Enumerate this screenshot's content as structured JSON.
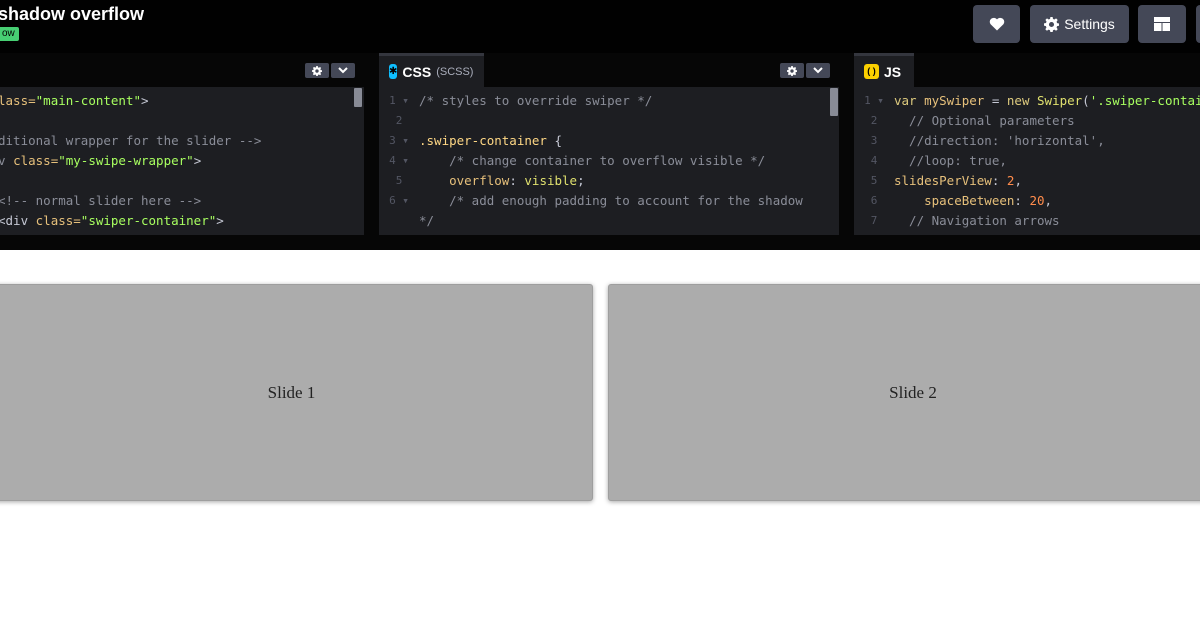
{
  "header": {
    "title": "shadow overflow",
    "badge": "ow",
    "settings_label": "Settings"
  },
  "panes": {
    "html": {
      "lines": [
        {
          "num": "",
          "fold": false,
          "parts": [
            {
              "t": "lass=",
              "c": "sl-attr"
            },
            {
              "t": "\"main-content\"",
              "c": "sl-str"
            },
            {
              "t": ">",
              "c": ""
            }
          ]
        },
        {
          "num": "",
          "fold": false,
          "parts": []
        },
        {
          "num": "",
          "fold": false,
          "parts": [
            {
              "t": "ditional wrapper for the slider -->",
              "c": "sl-com"
            }
          ]
        },
        {
          "num": "",
          "fold": false,
          "parts": [
            {
              "t": "v ",
              "c": "sl-com"
            },
            {
              "t": "class=",
              "c": "sl-attr"
            },
            {
              "t": "\"my-swipe-wrapper\"",
              "c": "sl-str"
            },
            {
              "t": ">",
              "c": ""
            }
          ]
        },
        {
          "num": "",
          "fold": false,
          "parts": []
        },
        {
          "num": "",
          "fold": false,
          "parts": [
            {
              "t": "<!-- normal slider here -->",
              "c": "sl-com"
            }
          ]
        },
        {
          "num": "",
          "fold": false,
          "parts": [
            {
              "t": "<div ",
              "c": ""
            },
            {
              "t": "class=",
              "c": "sl-attr"
            },
            {
              "t": "\"swiper-container\"",
              "c": "sl-str"
            },
            {
              "t": ">",
              "c": ""
            }
          ]
        }
      ]
    },
    "css": {
      "tab_label": "CSS",
      "tab_sub": "(SCSS)",
      "lines": [
        {
          "num": "1",
          "fold": true,
          "parts": [
            {
              "t": "/* styles to override swiper */",
              "c": "sl-com"
            }
          ]
        },
        {
          "num": "2",
          "fold": false,
          "parts": []
        },
        {
          "num": "3",
          "fold": true,
          "parts": [
            {
              "t": ".swiper-container",
              "c": "sl-sel"
            },
            {
              "t": " {",
              "c": ""
            }
          ]
        },
        {
          "num": "4",
          "fold": true,
          "parts": [
            {
              "t": "    /* change container to overflow visible */",
              "c": "sl-com"
            }
          ]
        },
        {
          "num": "5",
          "fold": false,
          "parts": [
            {
              "t": "    ",
              "c": ""
            },
            {
              "t": "overflow",
              "c": "sl-attr"
            },
            {
              "t": ": ",
              "c": ""
            },
            {
              "t": "visible",
              "c": "sl-fn"
            },
            {
              "t": ";",
              "c": ""
            }
          ]
        },
        {
          "num": "6",
          "fold": true,
          "parts": [
            {
              "t": "    /* add enough padding to account for the shadow",
              "c": "sl-com"
            }
          ]
        },
        {
          "num": "",
          "fold": false,
          "parts": [
            {
              "t": "*/",
              "c": "sl-com"
            }
          ]
        }
      ]
    },
    "js": {
      "tab_label": "JS",
      "lines": [
        {
          "num": "1",
          "fold": true,
          "parts": [
            {
              "t": "var ",
              "c": "sl-kw"
            },
            {
              "t": "mySwiper ",
              "c": "sl-attr"
            },
            {
              "t": "= ",
              "c": ""
            },
            {
              "t": "new ",
              "c": "sl-kw"
            },
            {
              "t": "Swiper",
              "c": "sl-fn"
            },
            {
              "t": "(",
              "c": ""
            },
            {
              "t": "'.swiper-contain",
              "c": "sl-str"
            }
          ]
        },
        {
          "num": "2",
          "fold": false,
          "parts": [
            {
              "t": "  // Optional parameters",
              "c": "sl-com"
            }
          ]
        },
        {
          "num": "3",
          "fold": false,
          "parts": [
            {
              "t": "  //direction: 'horizontal',",
              "c": "sl-com"
            }
          ]
        },
        {
          "num": "4",
          "fold": false,
          "parts": [
            {
              "t": "  //loop: true,",
              "c": "sl-com"
            }
          ]
        },
        {
          "num": "5",
          "fold": false,
          "parts": [
            {
              "t": "slidesPerView",
              "c": "sl-attr"
            },
            {
              "t": ": ",
              "c": ""
            },
            {
              "t": "2",
              "c": "sl-num"
            },
            {
              "t": ",",
              "c": ""
            }
          ]
        },
        {
          "num": "6",
          "fold": false,
          "parts": [
            {
              "t": "    spaceBetween",
              "c": "sl-attr"
            },
            {
              "t": ": ",
              "c": ""
            },
            {
              "t": "20",
              "c": "sl-num"
            },
            {
              "t": ",",
              "c": ""
            }
          ]
        },
        {
          "num": "7",
          "fold": false,
          "parts": [
            {
              "t": "  // Navigation arrows",
              "c": "sl-com"
            }
          ]
        }
      ]
    }
  },
  "slides": [
    "Slide 1",
    "Slide 2"
  ],
  "colors": {
    "badge": "#47cf73",
    "button": "#444857",
    "editor_bg": "#1d1e22",
    "css_icon": "#0ebeff",
    "js_icon": "#fcd000"
  }
}
